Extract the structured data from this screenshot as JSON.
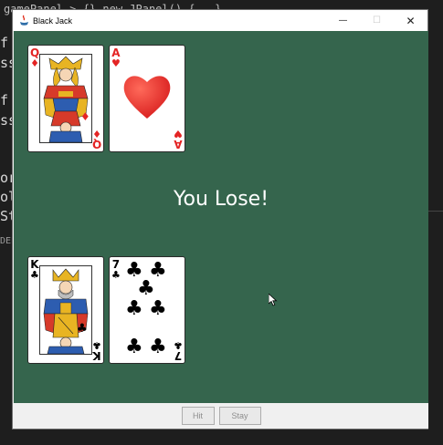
{
  "background_ide": {
    "tab_text": "gamePanel > {} new JPanel() {...}",
    "code_fragments": [
      "f",
      "ss",
      "f",
      "ss",
      "or",
      "ol",
      "St"
    ],
    "debug_label": "DEE"
  },
  "window": {
    "title": "Black Jack",
    "controls": {
      "minimize": "—",
      "maximize": "☐",
      "close": "✕"
    }
  },
  "table": {
    "background_color": "#35654d",
    "dealer_cards": [
      {
        "rank": "Q",
        "suit": "♦",
        "suit_name": "diamonds",
        "color": "red"
      },
      {
        "rank": "A",
        "suit": "♥",
        "suit_name": "hearts",
        "color": "red"
      }
    ],
    "player_cards": [
      {
        "rank": "K",
        "suit": "♣",
        "suit_name": "clubs",
        "color": "black"
      },
      {
        "rank": "7",
        "suit": "♣",
        "suit_name": "clubs",
        "color": "black"
      }
    ],
    "result_message": "You Lose!"
  },
  "buttons": {
    "hit_label": "Hit",
    "stay_label": "Stay",
    "enabled": false
  }
}
